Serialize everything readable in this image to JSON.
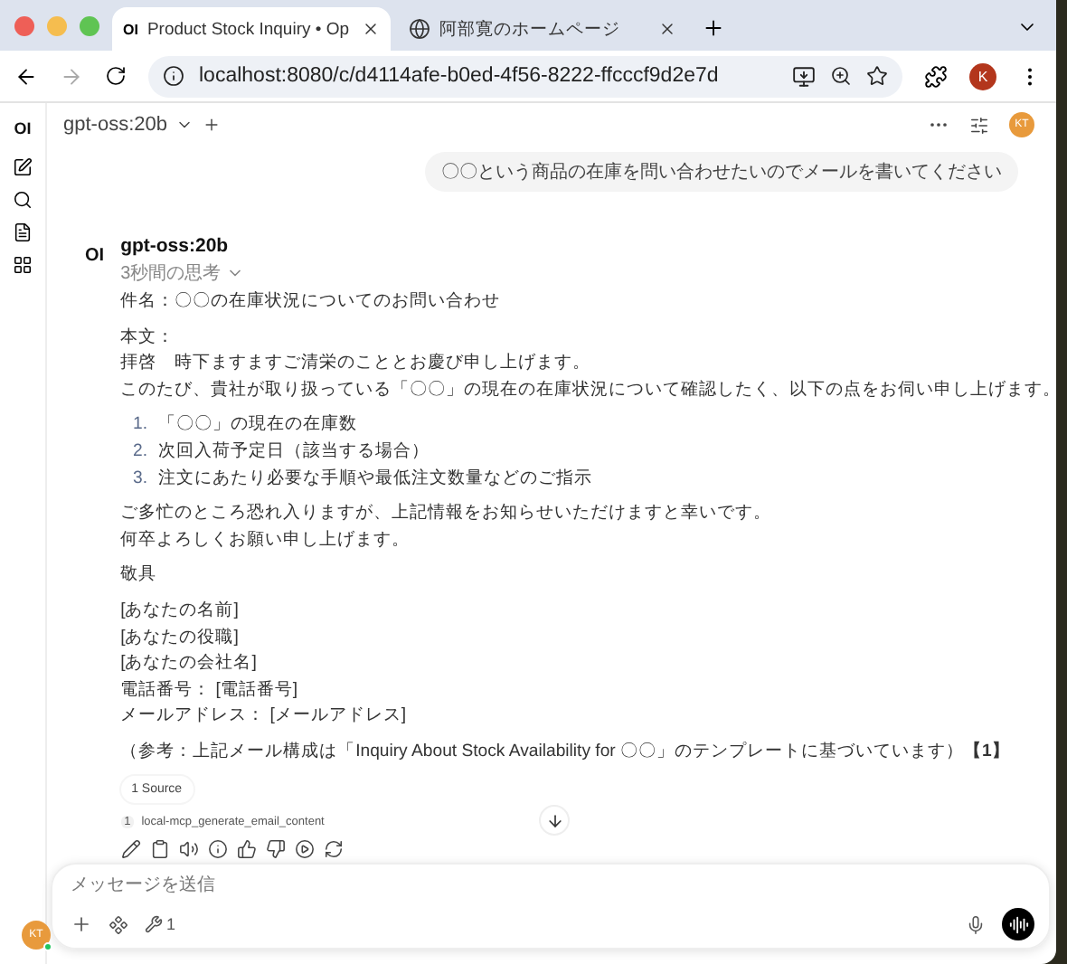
{
  "browser": {
    "tabs": [
      {
        "title": "Product Stock Inquiry • Op",
        "selected": true,
        "kind": "app",
        "favicon": "OI"
      },
      {
        "title": "阿部寛のホームページ",
        "selected": false,
        "kind": "web"
      }
    ],
    "address": "localhost:8080/c/d4114afe-b0ed-4f56-8222-ffcccf9d2e7d",
    "profile": "K"
  },
  "sidebar": {
    "logo": "OI"
  },
  "header": {
    "model": "gpt-oss:20b",
    "avatar": "KT"
  },
  "user_message": "〇〇という商品の在庫を問い合わせたいのでメールを書いてください",
  "assistant": {
    "logo": "OI",
    "name": "gpt-oss:20b",
    "thinking": "3秒間の思考",
    "blocks": [
      {
        "kind": "para",
        "lines": [
          "件名：〇〇の在庫状況についてのお問い合わせ"
        ]
      },
      {
        "kind": "para",
        "lines": [
          "本文：",
          "拝啓　時下ますますご清栄のこととお慶び申し上げます。",
          "このたび、貴社が取り扱っている「〇〇」の現在の在庫状況について確認したく、以下の点をお伺い申し上げます。"
        ]
      },
      {
        "kind": "list",
        "items": [
          {
            "number": "1.",
            "text": "「〇〇」の現在の在庫数"
          },
          {
            "number": "2.",
            "text": "次回入荷予定日（該当する場合）"
          },
          {
            "number": "3.",
            "text": "注文にあたり必要な手順や最低注文数量などのご指示"
          }
        ]
      },
      {
        "kind": "para",
        "lines": [
          "ご多忙のところ恐れ入りますが、上記情報をお知らせいただけますと幸いです。",
          "何卒よろしくお願い申し上げます。"
        ]
      },
      {
        "kind": "para",
        "lines": [
          "敬具"
        ]
      },
      {
        "kind": "para",
        "lines": [
          "[あなたの名前]",
          "[あなたの役職]",
          "[あなたの会社名]",
          "電話番号： [電話番号]",
          "メールアドレス： [メールアドレス]"
        ]
      },
      {
        "kind": "para",
        "lines": [
          "（参考：上記メール構成は「Inquiry About Stock Availability for 〇〇」のテンプレートに基づいています）**【1】**"
        ]
      }
    ],
    "sources_button": "1 Source",
    "sources": [
      {
        "index": "1",
        "name": "local-mcp_generate_email_content"
      }
    ]
  },
  "composer": {
    "placeholder": "メッセージを送信",
    "tool_count": "1"
  },
  "account": {
    "avatar": "KT",
    "online": true
  }
}
